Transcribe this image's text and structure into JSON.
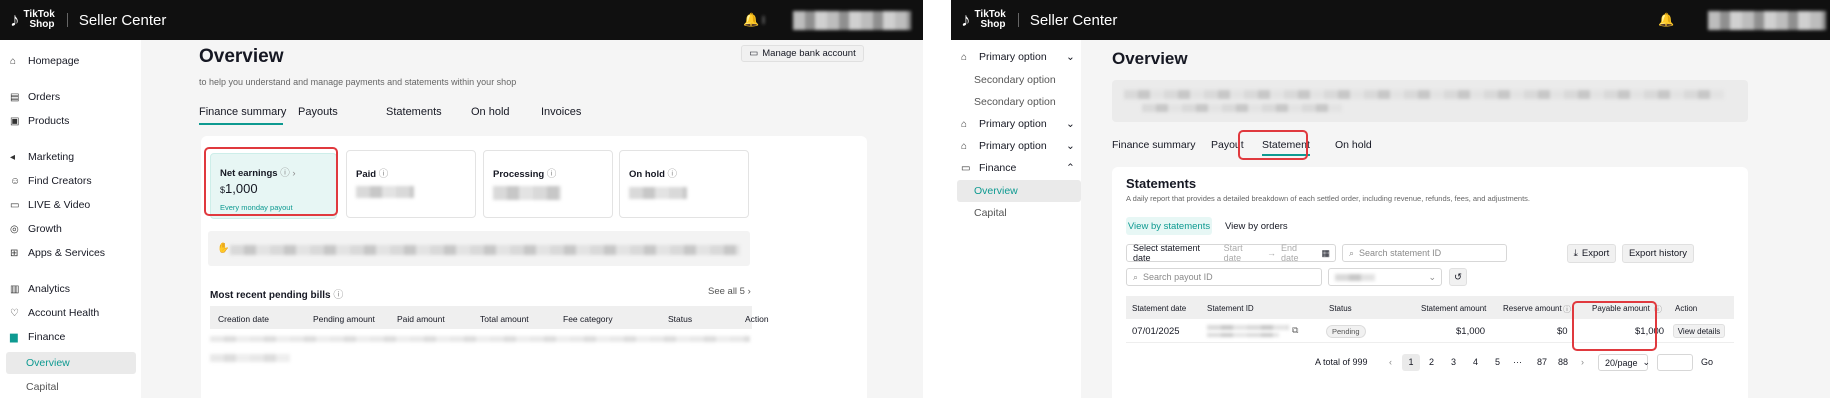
{
  "brand": {
    "logo_line1": "TikTok",
    "logo_line2": "Shop",
    "app_name": "Seller Center"
  },
  "colors": {
    "accent": "#0e9a91",
    "highlight": "#e0393e",
    "topbar": "#101010"
  },
  "left": {
    "sidebar": {
      "items": [
        {
          "label": "Homepage",
          "icon": "home-icon"
        },
        {
          "label": "Orders",
          "icon": "clipboard-icon"
        },
        {
          "label": "Products",
          "icon": "box-icon"
        },
        {
          "label": "Marketing",
          "icon": "megaphone-icon"
        },
        {
          "label": "Find Creators",
          "icon": "people-icon"
        },
        {
          "label": "LIVE & Video",
          "icon": "video-icon"
        },
        {
          "label": "Growth",
          "icon": "growth-icon"
        },
        {
          "label": "Apps & Services",
          "icon": "apps-icon"
        },
        {
          "label": "Analytics",
          "icon": "chart-icon"
        },
        {
          "label": "Account Health",
          "icon": "shield-icon"
        },
        {
          "label": "Finance",
          "icon": "wallet-icon"
        }
      ],
      "sub": [
        "Overview",
        "Capital"
      ]
    },
    "title": "Overview",
    "description": "to help you understand and manage payments and statements within your shop",
    "manage_bank": "Manage bank account",
    "tabs": [
      "Finance summary",
      "Payouts",
      "Statements",
      "On hold",
      "Invoices"
    ],
    "cards": {
      "net": {
        "label": "Net earnings",
        "currency": "$",
        "amount": "1,000",
        "note": "Every monday payout"
      },
      "paid": "Paid",
      "processing": "Processing",
      "onhold": "On hold"
    },
    "bills": {
      "title": "Most recent pending bills",
      "see_all": "See all 5",
      "columns": [
        "Creation date",
        "Pending amount",
        "Paid amount",
        "Total amount",
        "Fee category",
        "Status",
        "Action"
      ]
    }
  },
  "right": {
    "sidebar": {
      "primary": "Primary option",
      "secondary": "Secondary option",
      "finance": "Finance",
      "sub": [
        "Overview",
        "Capital"
      ]
    },
    "title": "Overview",
    "tabs": [
      "Finance summary",
      "Payout",
      "Statement",
      "On hold"
    ],
    "statements": {
      "title": "Statements",
      "description": "A daily report that provides a detailed breakdown of each settled order, including revenue, refunds, fees, and adjustments.",
      "view_by_statements": "View by statements",
      "view_by_orders": "View by orders",
      "date_label": "Select statement date",
      "start_ph": "Start date",
      "end_ph": "End date",
      "search_statement_ph": "Search statement ID",
      "search_payout_ph": "Search payout ID",
      "export": "Export",
      "export_history": "Export history",
      "columns": [
        "Statement date",
        "Statement ID",
        "Status",
        "Statement amount",
        "Reserve amount",
        "Payable amount",
        "Action"
      ],
      "row": {
        "date": "07/01/2025",
        "status": "Pending",
        "statement_amount": "$1,000",
        "reserve_amount": "$0",
        "payable_amount": "$1,000",
        "action": "View details"
      },
      "pagination": {
        "total": "A total of 999",
        "pages": [
          "1",
          "2",
          "3",
          "4",
          "5",
          "···",
          "87",
          "88"
        ],
        "per_page": "20/page",
        "go": "Go"
      }
    }
  }
}
